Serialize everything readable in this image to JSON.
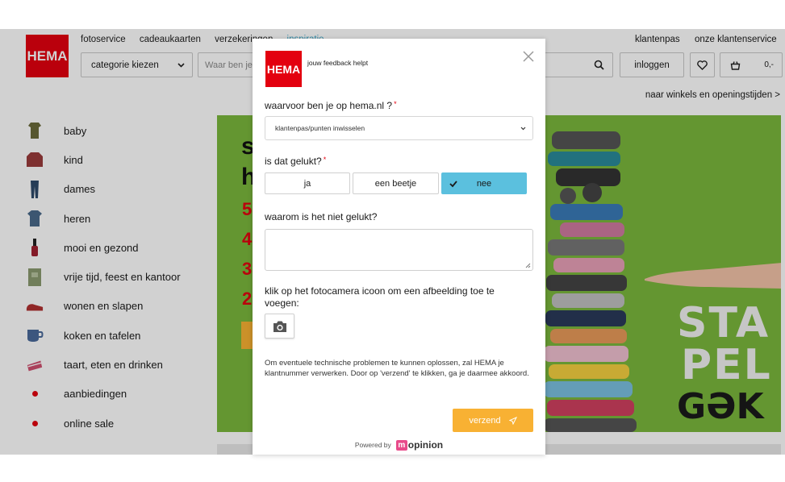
{
  "site": {
    "logo": "HEMA",
    "topnav": [
      "fotoservice",
      "cadeaukaarten",
      "verzekeringen",
      "inspiratie"
    ],
    "top_right": [
      "klantenpas",
      "onze klantenservice"
    ],
    "category_select": "categorie kiezen",
    "search_placeholder": "Waar ben je naar op zoek?",
    "login": "inloggen",
    "cart_amount": "0,-",
    "stores_link": "naar winkels en openingstijden >",
    "sidebar": [
      {
        "label": "baby",
        "icon": "baby-clothes-icon",
        "color": "#6b6b3a"
      },
      {
        "label": "kind",
        "icon": "sweater-icon",
        "color": "#9a3b3b"
      },
      {
        "label": "dames",
        "icon": "jeans-icon",
        "color": "#2e4a6a"
      },
      {
        "label": "heren",
        "icon": "shirt-icon",
        "color": "#4a6a8a"
      },
      {
        "label": "mooi en gezond",
        "icon": "nail-polish-icon",
        "color": "#a02030"
      },
      {
        "label": "vrije tijd, feest en kantoor",
        "icon": "notebook-icon",
        "color": "#8a9a70"
      },
      {
        "label": "wonen en slapen",
        "icon": "slipper-icon",
        "color": "#b03030"
      },
      {
        "label": "koken en tafelen",
        "icon": "mug-icon",
        "color": "#4a6a9a"
      },
      {
        "label": "taart, eten en drinken",
        "icon": "cake-icon",
        "color": "#d05070"
      },
      {
        "label": "aanbiedingen",
        "icon": "dot-icon",
        "color": "#e3000f"
      },
      {
        "label": "online sale",
        "icon": "dot-icon",
        "color": "#e3000f"
      }
    ],
    "banner": {
      "line1": "s",
      "line2": "h",
      "reds": [
        "5",
        "4",
        "3",
        "2"
      ],
      "stapel_1": "STA",
      "stapel_2": "PEL",
      "gek": "GƏK"
    }
  },
  "modal": {
    "logo": "HEMA",
    "header": "jouw feedback helpt",
    "q1": "waarvoor ben je op hema.nl ?",
    "q1_value": "klantenpas/punten inwisselen",
    "q2": "is dat gelukt?",
    "options": [
      "ja",
      "een beetje",
      "nee"
    ],
    "selected_option": "nee",
    "q3": "waarom is het niet gelukt?",
    "q4": "klik op het fotocamera icoon om een afbeelding toe te voegen:",
    "note": "Om eventuele technische problemen te kunnen oplossen, zal HEMA je klantnummer verwerken. Door op 'verzend' te klikken, ga je daarmee akkoord.",
    "send": "verzend",
    "powered_by": "Powered by",
    "powered_brand": "opinion",
    "powered_brand_initial": "m",
    "required_mark": "*",
    "colors": {
      "brand": "#e3000f",
      "selected": "#5bc0de",
      "send": "#f8b133"
    }
  }
}
